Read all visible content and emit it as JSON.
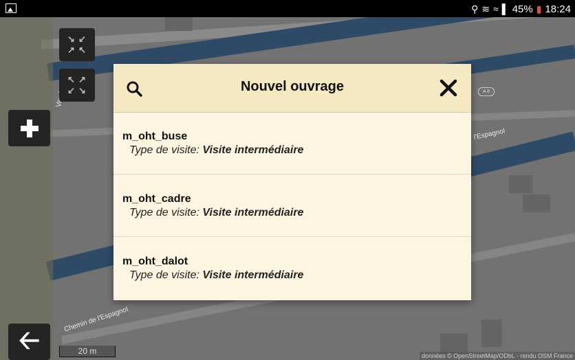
{
  "status_bar": {
    "battery": "45%",
    "time": "18:24",
    "icons": [
      "location-icon",
      "vibrate-icon",
      "wifi-icon",
      "signal-icon",
      "battery-icon"
    ]
  },
  "map": {
    "road_labels": [
      "Chemin de l'Espagnol",
      "l'Espagnol",
      "Vaudule"
    ],
    "road_badge": "A 8",
    "scale": "20 m",
    "attribution": "données © OpenStreetMap/ODbL - rendu OSM France"
  },
  "dialog": {
    "title": "Nouvel ouvrage",
    "items": [
      {
        "name": "m_oht_buse",
        "label": "Type de visite:",
        "value": "Visite intermédiaire"
      },
      {
        "name": "m_oht_cadre",
        "label": "Type de visite:",
        "value": "Visite intermédiaire"
      },
      {
        "name": "m_oht_dalot",
        "label": "Type de visite:",
        "value": "Visite intermédiaire"
      }
    ]
  },
  "colors": {
    "dialog_header": "#f5e9c4",
    "dialog_body": "#fdf5e1",
    "road": "#2f4a66"
  }
}
